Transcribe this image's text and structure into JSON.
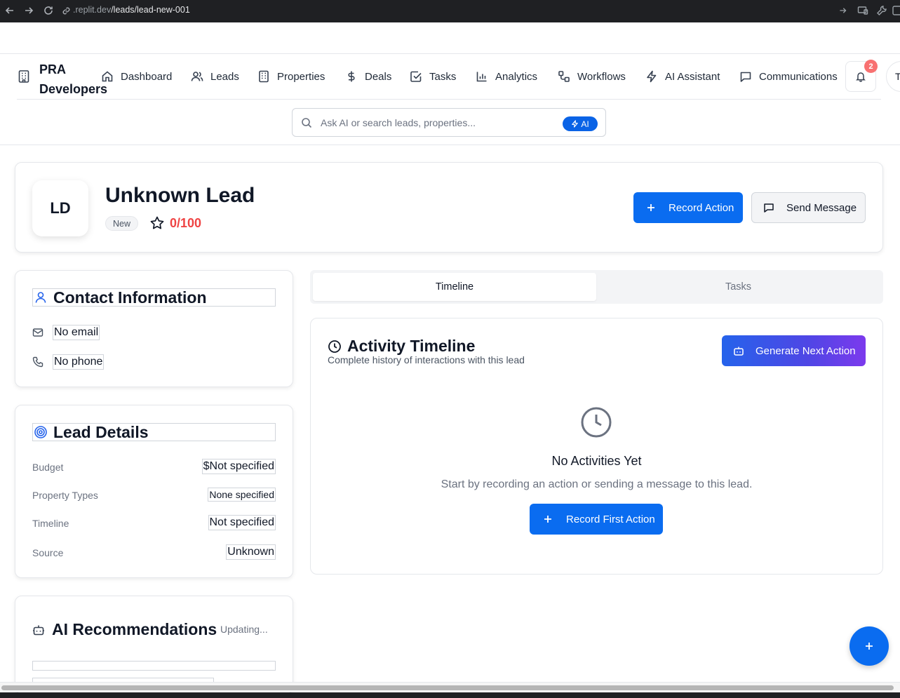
{
  "browser": {
    "url_prefix": ".replit.dev",
    "url_path": "/leads/lead-new-001"
  },
  "header": {
    "brand": "PRA Developers",
    "nav": [
      {
        "label": "Dashboard",
        "icon": "home-icon"
      },
      {
        "label": "Leads",
        "icon": "users-icon"
      },
      {
        "label": "Properties",
        "icon": "building-icon"
      },
      {
        "label": "Deals",
        "icon": "dollar-icon"
      },
      {
        "label": "Tasks",
        "icon": "check-square-icon"
      },
      {
        "label": "Analytics",
        "icon": "bar-chart-icon"
      },
      {
        "label": "Workflows",
        "icon": "workflow-icon"
      },
      {
        "label": "AI Assistant",
        "icon": "zap-icon"
      },
      {
        "label": "Communications",
        "icon": "message-icon"
      }
    ],
    "notification_count": "2",
    "avatar_initial": "T",
    "search": {
      "placeholder": "Ask AI or search leads, properties...",
      "ai_label": "AI"
    }
  },
  "lead": {
    "initials": "LD",
    "name": "Unknown Lead",
    "status": "New",
    "score": "0/100",
    "record_action": "Record Action",
    "send_message": "Send Message"
  },
  "contact": {
    "title": "Contact Information",
    "email": "No email",
    "phone": "No phone"
  },
  "details": {
    "title": "Lead Details",
    "rows": [
      {
        "label": "Budget",
        "value": "$Not specified"
      },
      {
        "label": "Property Types",
        "value": "None specified"
      },
      {
        "label": "Timeline",
        "value": "Not specified"
      },
      {
        "label": "Source",
        "value": "Unknown"
      }
    ]
  },
  "ai_recommendations": {
    "title": "AI Recommendations",
    "status": "Updating..."
  },
  "tabs": [
    "Timeline",
    "Tasks"
  ],
  "timeline": {
    "title": "Activity Timeline",
    "subtitle": "Complete history of interactions with this lead",
    "generate_button": "Generate Next Action",
    "empty_title": "No Activities Yet",
    "empty_subtitle": "Start by recording an action or sending a message to this lead.",
    "first_action_button": "Record First Action"
  },
  "colors": {
    "primary": "#0a6cf0",
    "score": "#ef4444",
    "badge": "#f87171"
  }
}
